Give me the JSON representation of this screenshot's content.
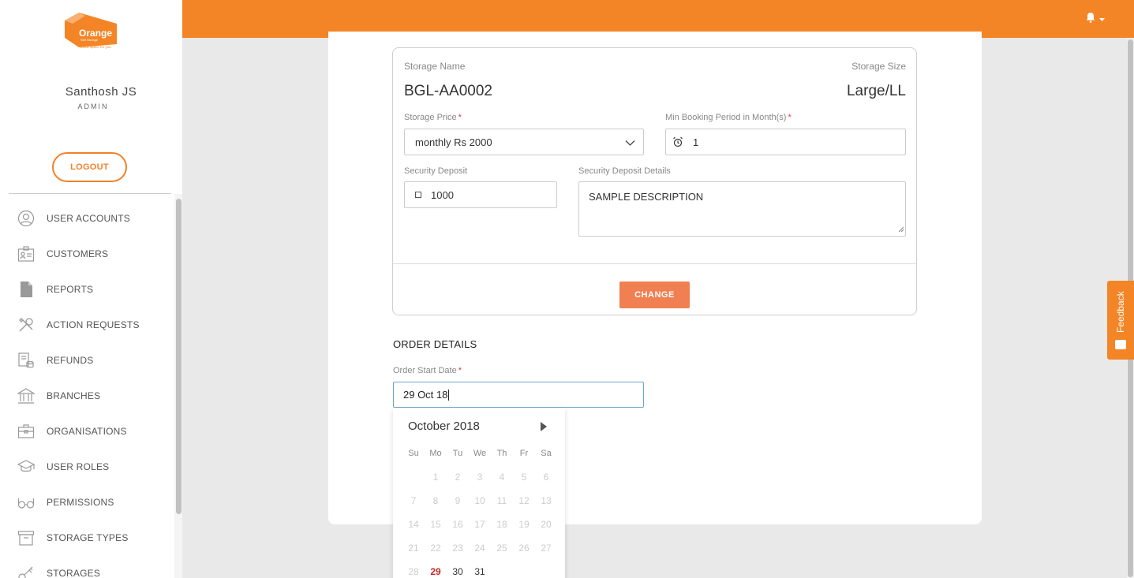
{
  "brand": {
    "logo_text": "Orange",
    "logo_sub": "Self Storage",
    "logo_tagline": "Extra space for you"
  },
  "user": {
    "name": "Santhosh JS",
    "role": "ADMIN"
  },
  "logout_label": "LOGOUT",
  "sidebar": {
    "items": [
      {
        "label": "USER ACCOUNTS",
        "icon": "user-circle-icon"
      },
      {
        "label": "CUSTOMERS",
        "icon": "id-card-icon"
      },
      {
        "label": "REPORTS",
        "icon": "document-icon"
      },
      {
        "label": "ACTION REQUESTS",
        "icon": "tools-icon"
      },
      {
        "label": "REFUNDS",
        "icon": "receipt-coins-icon"
      },
      {
        "label": "BRANCHES",
        "icon": "bank-icon"
      },
      {
        "label": "ORGANISATIONS",
        "icon": "briefcase-icon"
      },
      {
        "label": "USER ROLES",
        "icon": "graduation-cap-icon"
      },
      {
        "label": "PERMISSIONS",
        "icon": "glasses-icon"
      },
      {
        "label": "STORAGE TYPES",
        "icon": "archive-box-icon"
      },
      {
        "label": "STORAGES",
        "icon": "key-icon"
      }
    ]
  },
  "storage": {
    "name_label": "Storage Name",
    "name_value": "BGL-AA0002",
    "size_label": "Storage Size",
    "size_value": "Large/LL",
    "price_label": "Storage Price",
    "price_value": "monthly Rs 2000",
    "min_period_label": "Min Booking Period in Month(s)",
    "min_period_value": "1",
    "deposit_label": "Security Deposit",
    "deposit_value": "1000",
    "deposit_details_label": "Security Deposit Details",
    "deposit_details_value": "SAMPLE DESCRIPTION",
    "required_mark": "*",
    "change_label": "CHANGE"
  },
  "order": {
    "section_title": "ORDER DETAILS",
    "start_date_label": "Order Start Date",
    "start_date_value": "29 Oct 18"
  },
  "calendar": {
    "month_title": "October 2018",
    "weekdays": [
      "Su",
      "Mo",
      "Tu",
      "We",
      "Th",
      "Fr",
      "Sa"
    ],
    "weeks": [
      [
        "",
        "1",
        "2",
        "3",
        "4",
        "5",
        "6"
      ],
      [
        "7",
        "8",
        "9",
        "10",
        "11",
        "12",
        "13"
      ],
      [
        "14",
        "15",
        "16",
        "17",
        "18",
        "19",
        "20"
      ],
      [
        "21",
        "22",
        "23",
        "24",
        "25",
        "26",
        "27"
      ],
      [
        "28",
        "29",
        "30",
        "31",
        "",
        "",
        ""
      ]
    ],
    "today": "29",
    "enabled": [
      "29",
      "30",
      "31"
    ]
  },
  "feedback_label": "Feedback",
  "colors": {
    "accent": "#f38526",
    "button": "#f07f52",
    "today": "#c62828"
  }
}
